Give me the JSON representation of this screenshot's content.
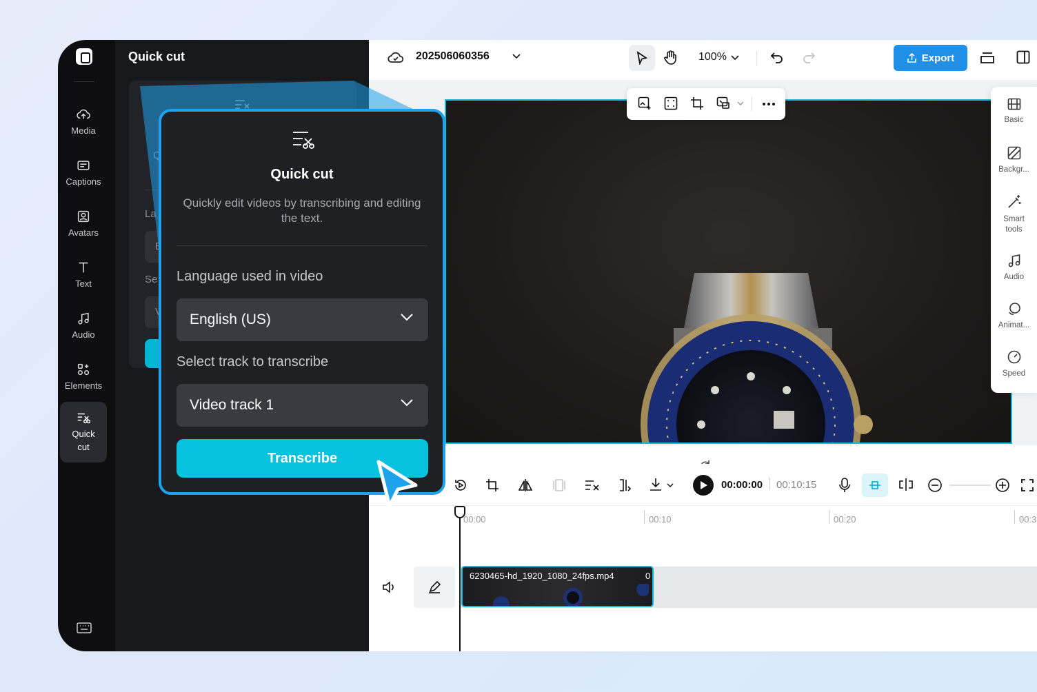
{
  "left_rail": {
    "items": [
      {
        "label": "Media"
      },
      {
        "label": "Captions"
      },
      {
        "label": "Avatars"
      },
      {
        "label": "Text"
      },
      {
        "label": "Audio"
      },
      {
        "label": "Elements"
      },
      {
        "label": "Quick cut",
        "line1": "Quick",
        "line2": "cut",
        "active": true
      }
    ]
  },
  "panel": {
    "title": "Quick cut",
    "ghost_texts": [
      "Q",
      "La",
      "E",
      "Se",
      "V"
    ]
  },
  "topbar": {
    "project_name": "202506060356",
    "zoom": "100%",
    "export_label": "Export"
  },
  "right_props": {
    "items": [
      {
        "label": "Basic"
      },
      {
        "label": "Backgr..."
      },
      {
        "label": "Smart tools",
        "line1": "Smart",
        "line2": "tools"
      },
      {
        "label": "Audio"
      },
      {
        "label": "Animat..."
      },
      {
        "label": "Speed"
      }
    ]
  },
  "timeline": {
    "current_time": "00:00:00",
    "total_time": "00:10:15",
    "ruler": [
      "00:00",
      "00:10",
      "00:20",
      "00:3"
    ],
    "clip_name": "6230465-hd_1920_1080_24fps.mp4",
    "clip_badge": "0"
  },
  "popup": {
    "title": "Quick cut",
    "description": "Quickly edit videos by transcribing and editing the text.",
    "language_label": "Language used in video",
    "language_value": "English (US)",
    "track_label": "Select track to transcribe",
    "track_value": "Video track 1",
    "transcribe_label": "Transcribe"
  },
  "colors": {
    "accent_cyan": "#07c2de",
    "popup_border": "#1ea2ec",
    "export_blue": "#1f8fe8"
  }
}
